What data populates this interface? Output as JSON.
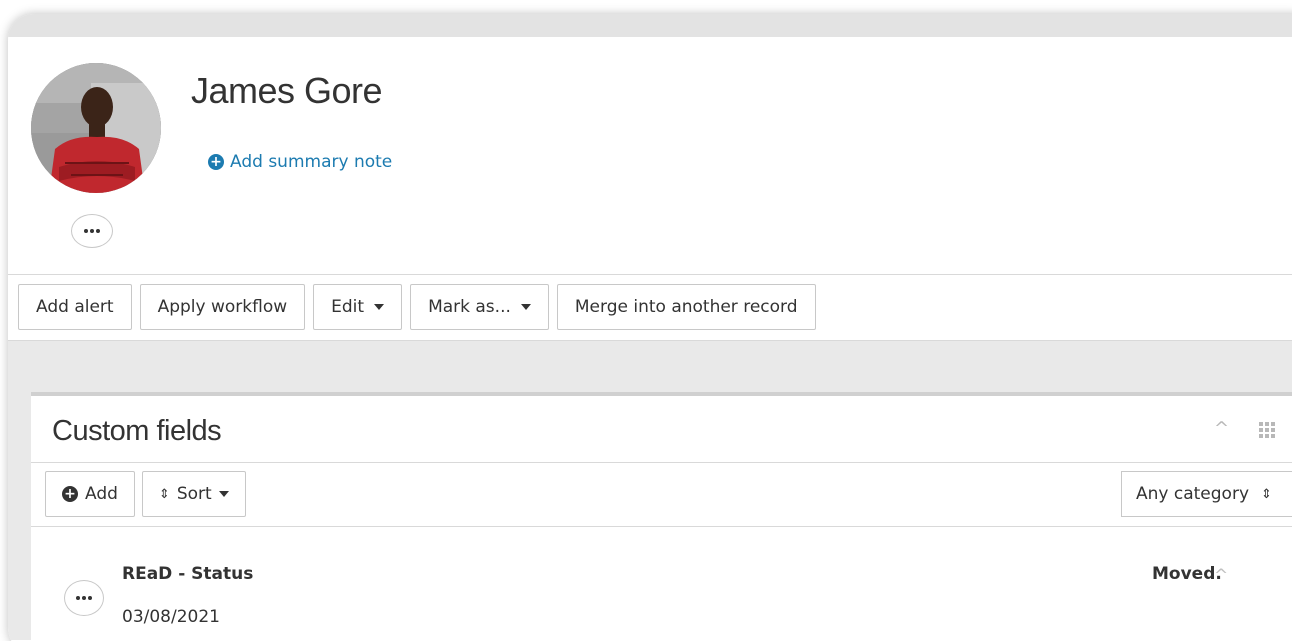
{
  "record": {
    "name": "James Gore",
    "summary_link": "Add summary note"
  },
  "toolbar": {
    "add_alert": "Add alert",
    "apply_workflow": "Apply workflow",
    "edit": "Edit",
    "mark_as": "Mark as...",
    "merge": "Merge into another record"
  },
  "custom_fields": {
    "title": "Custom fields",
    "add_label": "Add",
    "sort_label": "Sort",
    "category_select": "Any category",
    "rows": [
      {
        "name": "REaD - Status",
        "date": "03/08/2021",
        "value": "Moved."
      }
    ]
  },
  "colors": {
    "link": "#1c7bb0",
    "band": "#e9e9e9"
  },
  "icons": {
    "summary": "plus-circle-icon",
    "add": "plus-circle-icon",
    "sort": "sort-icon",
    "more": "ellipsis-icon",
    "collapse": "chevron-up-icon",
    "grid": "grid-icon"
  }
}
